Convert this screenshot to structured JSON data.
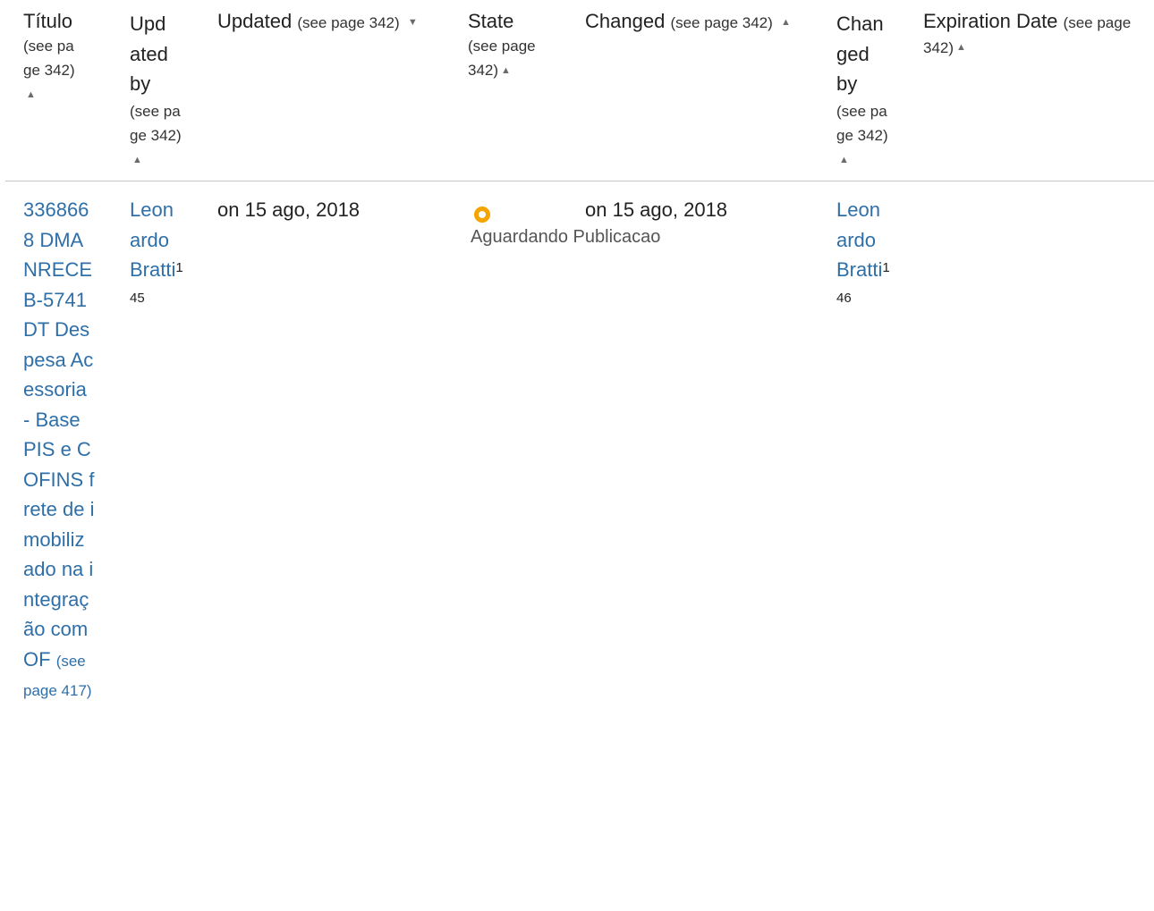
{
  "headers": {
    "titulo": {
      "label": "Título",
      "see": "(see page 342)"
    },
    "updated_by": {
      "label": "Updated by",
      "see": "(see page 342)"
    },
    "updated": {
      "label": "Updated",
      "see": "(see page 342)"
    },
    "state": {
      "label": "State",
      "see": "(see page 342)"
    },
    "changed": {
      "label": "Changed",
      "see": "(see page 342)"
    },
    "changed_by": {
      "label": "Changed by",
      "see": "(see page 342)"
    },
    "expiration": {
      "label": "Expiration Date",
      "see": "(see page 342)"
    }
  },
  "row": {
    "title": "3368668 DMANRECEB-5741 DT Despesa Acessoria - Base PIS e COFINS frete de imobilizado na integração com OF",
    "title_see": "(see page 417)",
    "updated_by_name": "Leonardo Bratti",
    "updated_by_ref": "145",
    "updated": "on 15 ago, 2018",
    "state": "Aguardando Publicacao",
    "changed": "on 15 ago, 2018",
    "changed_by_name": "Leonardo Bratti",
    "changed_by_ref": "146",
    "expiration": ""
  },
  "icons": {
    "sort_up": "▲",
    "sort_down": "▼",
    "state_icon": "circle-status-icon"
  },
  "colors": {
    "link": "#2f6fa8",
    "status": "#f5a400",
    "divider": "#c8c8c8"
  }
}
